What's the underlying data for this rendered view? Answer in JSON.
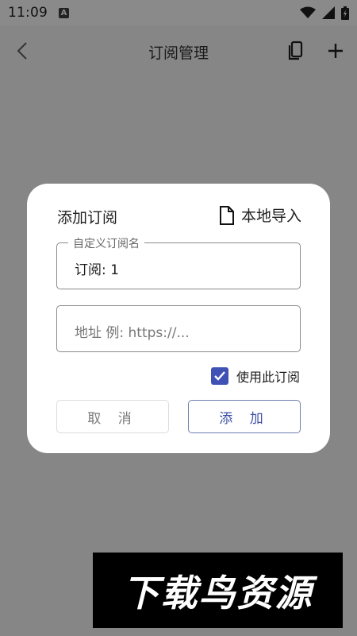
{
  "status_bar": {
    "time": "11:09",
    "notification_badge": "A"
  },
  "app_bar": {
    "title": "订阅管理"
  },
  "dialog": {
    "title": "添加订阅",
    "local_import_label": "本地导入",
    "name_field": {
      "legend": "自定义订阅名",
      "value": "订阅: 1"
    },
    "url_field": {
      "placeholder": "地址 例: https://..."
    },
    "use_subscription": {
      "label": "使用此订阅",
      "checked": true
    },
    "cancel_label": "取 消",
    "add_label": "添 加"
  },
  "watermark": {
    "text": "下载鸟资源"
  },
  "colors": {
    "accent": "#3f51b5",
    "scrim": "#868686",
    "dialog_bg": "#ffffff"
  }
}
